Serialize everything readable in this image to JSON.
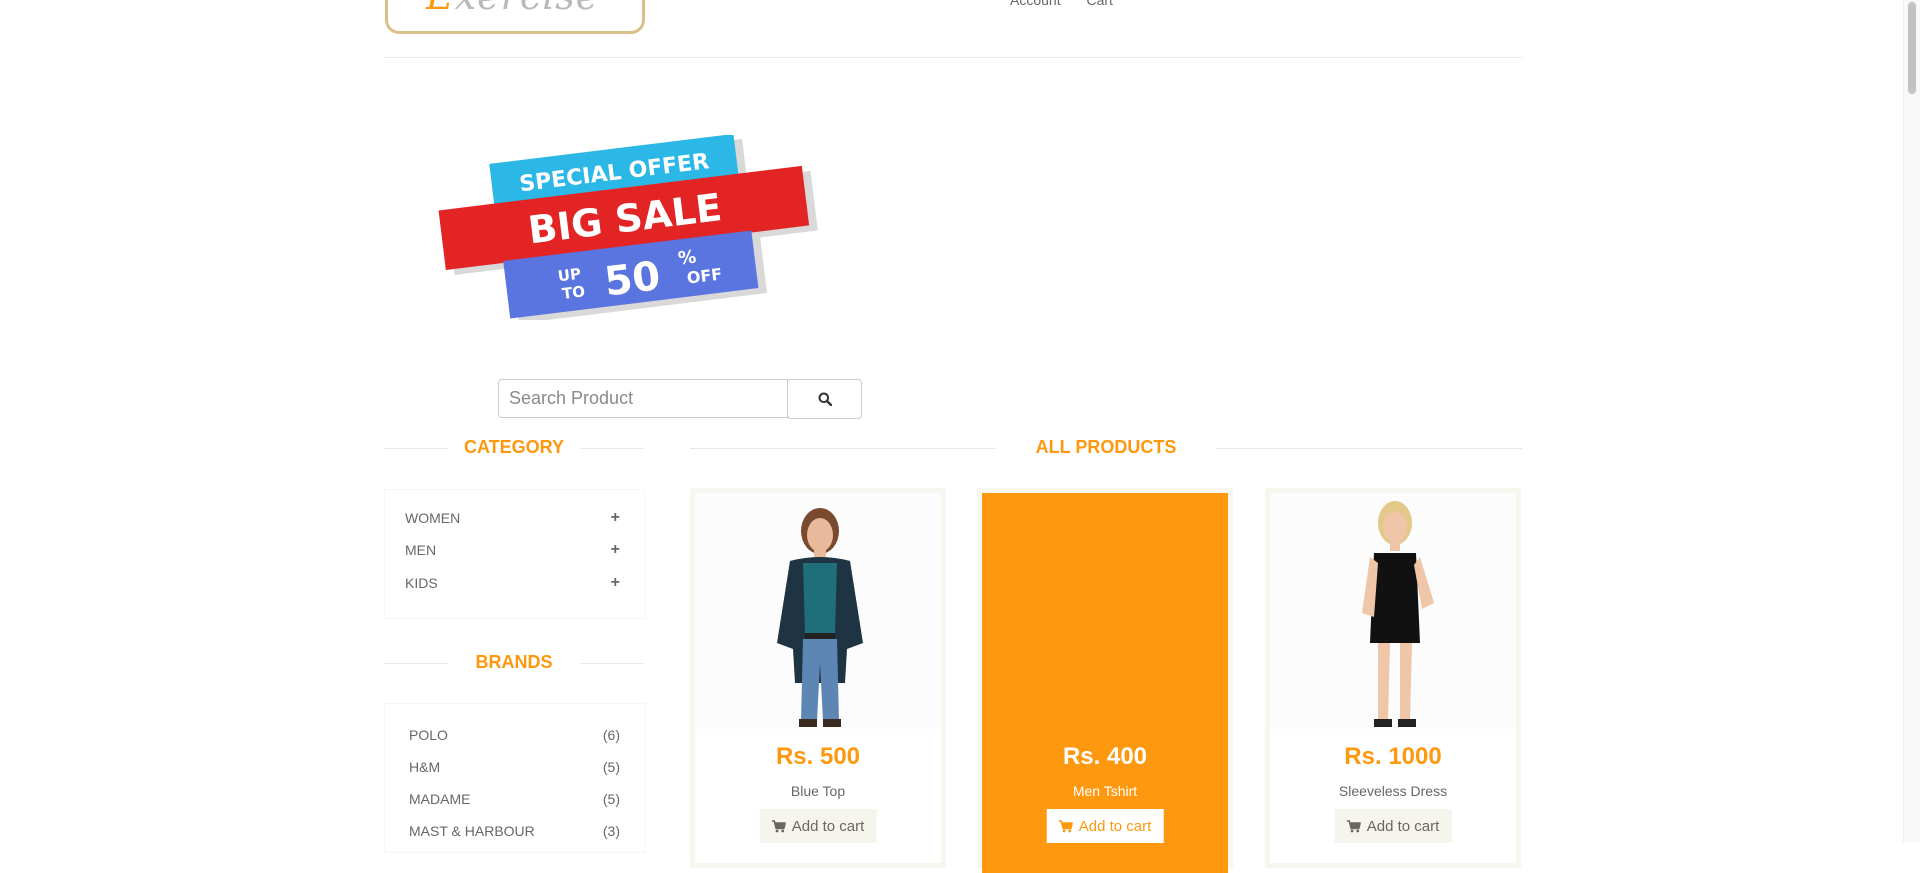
{
  "header": {
    "logo_first_letter": "E",
    "logo_rest": "xercise",
    "nav_items": [
      "Account",
      "Cart"
    ]
  },
  "banner": {
    "line1": "SPECIAL OFFER",
    "line2": "BIG SALE",
    "up": "UP",
    "to": "TO",
    "percent_value": "50",
    "percent_sign": "%",
    "off": "OFF",
    "colors": {
      "top": "#2cb8e6",
      "middle": "#e32424",
      "bottom": "#5a74e0"
    }
  },
  "search": {
    "placeholder": "Search Product",
    "button_icon": "search-icon"
  },
  "category": {
    "title": "CATEGORY",
    "items": [
      {
        "label": "WOMEN",
        "icon": "plus-icon"
      },
      {
        "label": "MEN",
        "icon": "plus-icon"
      },
      {
        "label": "KIDS",
        "icon": "plus-icon"
      }
    ]
  },
  "brands": {
    "title": "BRANDS",
    "items": [
      {
        "label": "POLO",
        "count": "(6)"
      },
      {
        "label": "H&M",
        "count": "(5)"
      },
      {
        "label": "MADAME",
        "count": "(5)"
      },
      {
        "label": "MAST & HARBOUR",
        "count": "(3)"
      }
    ]
  },
  "products": {
    "title": "ALL PRODUCTS",
    "add_label": "Add to cart",
    "cart_icon": "shopping-cart-icon",
    "accent_color": "#fe980f",
    "items": [
      {
        "price": "Rs. 500",
        "name": "Blue Top"
      },
      {
        "price": "Rs. 400",
        "name": "Men Tshirt"
      },
      {
        "price": "Rs. 1000",
        "name": "Sleeveless Dress"
      }
    ]
  }
}
